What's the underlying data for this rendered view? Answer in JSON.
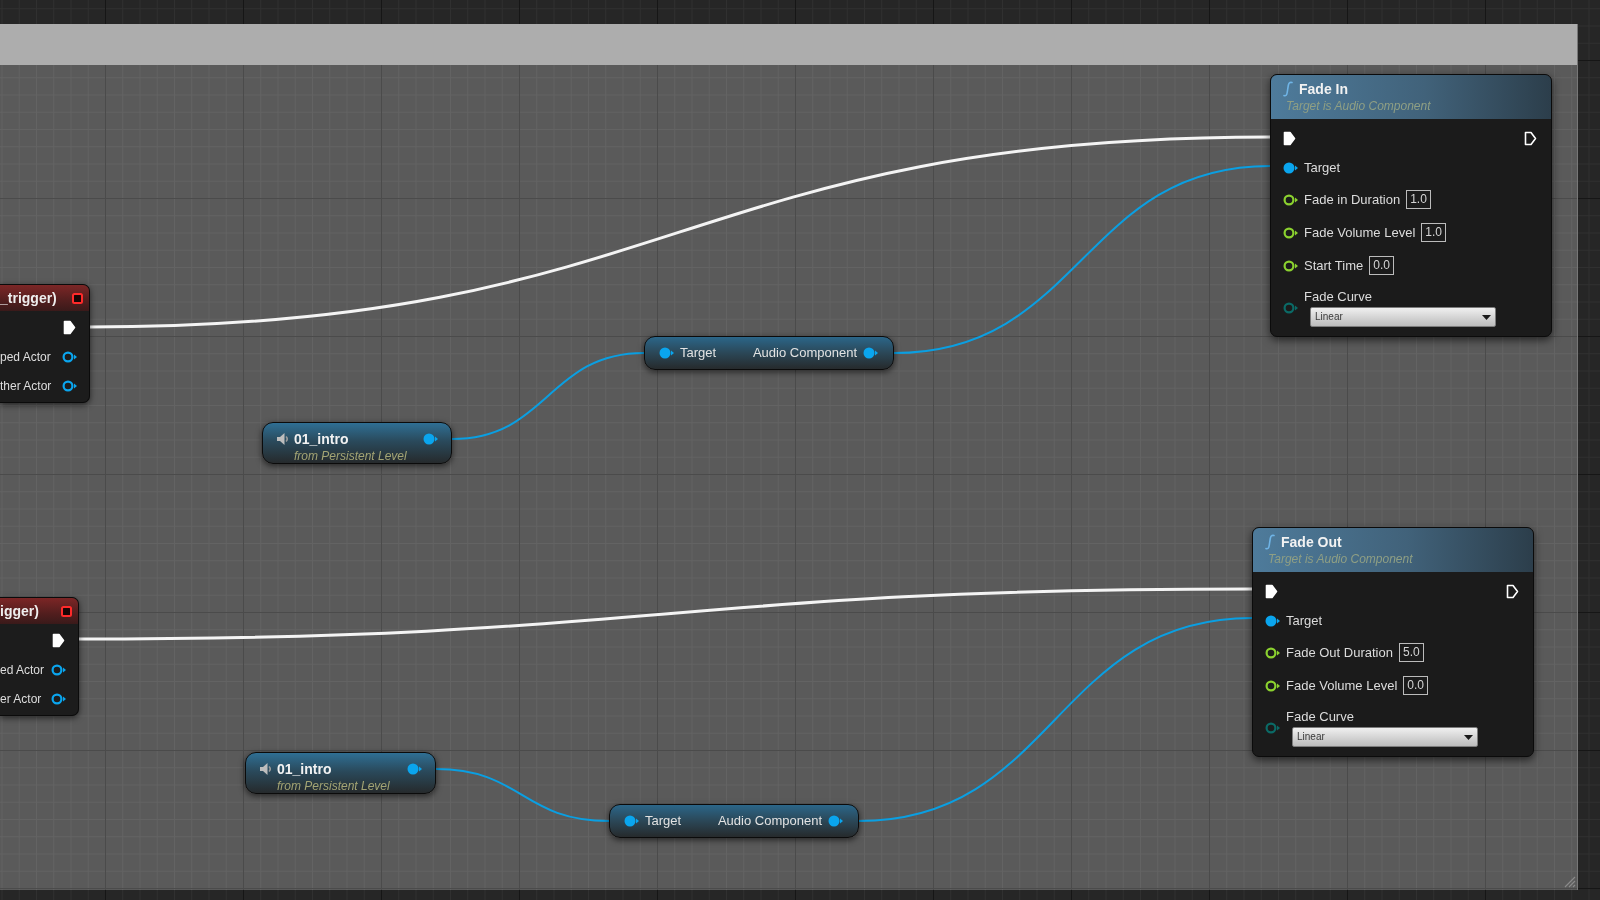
{
  "event_nodes": [
    {
      "title": "_trigger)",
      "pins": [
        {
          "kind": "exec",
          "connected": true
        },
        {
          "kind": "object",
          "label": "ped Actor",
          "connected": false
        },
        {
          "kind": "object",
          "label": "ther Actor",
          "connected": false
        }
      ]
    },
    {
      "title": "igger)",
      "pins": [
        {
          "kind": "exec",
          "connected": true
        },
        {
          "kind": "object",
          "label": "ed Actor",
          "connected": false
        },
        {
          "kind": "object",
          "label": "er Actor",
          "connected": false
        }
      ]
    }
  ],
  "level_actor_nodes": [
    {
      "name": "01_intro",
      "subtitle": "from Persistent Level",
      "connected": true
    },
    {
      "name": "01_intro",
      "subtitle": "from Persistent Level",
      "connected": true
    }
  ],
  "getter_nodes": [
    {
      "input": "Target",
      "input_connected": true,
      "output": "Audio Component",
      "output_connected": true
    },
    {
      "input": "Target",
      "input_connected": true,
      "output": "Audio Component",
      "output_connected": true
    }
  ],
  "function_nodes": [
    {
      "title": "Fade In",
      "subtitle": "Target is Audio Component",
      "exec_in_connected": true,
      "exec_out_connected": false,
      "pins": [
        {
          "kind": "object",
          "label": "Target",
          "connected": true
        },
        {
          "kind": "float",
          "label": "Fade in Duration",
          "value": "1.0",
          "connected": false
        },
        {
          "kind": "float",
          "label": "Fade Volume Level",
          "value": "1.0",
          "connected": false
        },
        {
          "kind": "float",
          "label": "Start Time",
          "value": "0.0",
          "connected": false
        },
        {
          "kind": "enum",
          "label": "Fade Curve",
          "value": "Linear",
          "connected": false
        }
      ]
    },
    {
      "title": "Fade Out",
      "subtitle": "Target is Audio Component",
      "exec_in_connected": true,
      "exec_out_connected": false,
      "pins": [
        {
          "kind": "object",
          "label": "Target",
          "connected": true
        },
        {
          "kind": "float",
          "label": "Fade Out Duration",
          "value": "5.0",
          "connected": false
        },
        {
          "kind": "float",
          "label": "Fade Volume Level",
          "value": "0.0",
          "connected": false
        },
        {
          "kind": "enum",
          "label": "Fade Curve",
          "value": "Linear",
          "connected": false
        }
      ]
    }
  ]
}
